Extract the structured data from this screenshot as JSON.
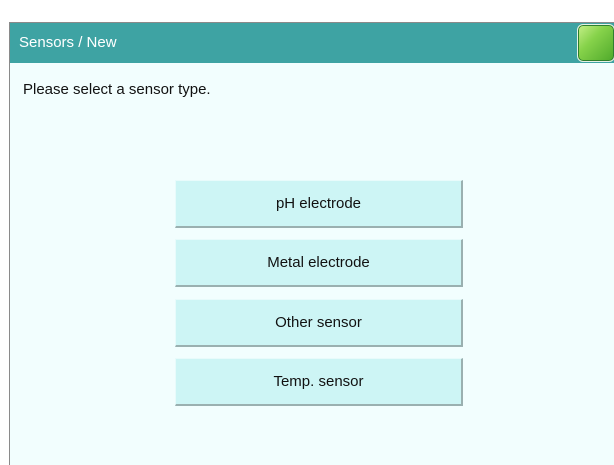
{
  "header": {
    "title": "Sensors / New",
    "status_icon": "status-led-icon",
    "status_color": "#6ec43c"
  },
  "main": {
    "prompt": "Please select a sensor type.",
    "options": [
      {
        "label": "pH electrode"
      },
      {
        "label": "Metal electrode"
      },
      {
        "label": "Other sensor"
      },
      {
        "label": "Temp. sensor"
      }
    ]
  },
  "colors": {
    "titlebar": "#3ea3a3",
    "background": "#f2fefe",
    "button": "#cdf5f5"
  }
}
